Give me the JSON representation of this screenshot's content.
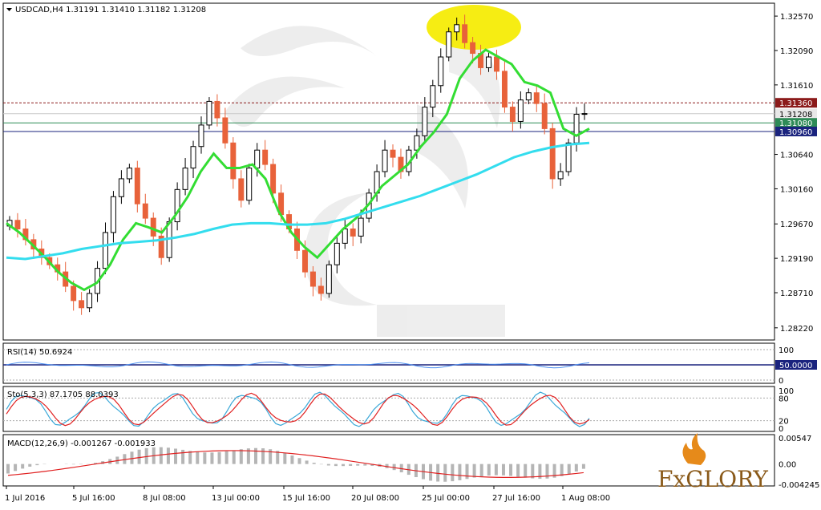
{
  "chart_data": {
    "type": "candlestick",
    "symbol_header": "USDCAD,H4  1.31191 1.31410 1.31182 1.31208",
    "price_axis": [
      "1.32570",
      "1.32090",
      "1.31610",
      "1.31360",
      "1.31208",
      "1.31080",
      "1.30960",
      "1.30640",
      "1.30160",
      "1.29670",
      "1.29190",
      "1.28710",
      "1.28220"
    ],
    "ylim": [
      1.2805,
      1.3275
    ],
    "time_labels": [
      "1 Jul 2016",
      "5 Jul 16:00",
      "8 Jul 08:00",
      "13 Jul 00:00",
      "15 Jul 16:00",
      "20 Jul 08:00",
      "25 Jul 00:00",
      "27 Jul 16:00",
      "1 Aug 08:00"
    ],
    "levels": [
      {
        "value": 1.3136,
        "label": "1.31360",
        "color": "#8b1a1a",
        "style": "dashed"
      },
      {
        "value": 1.31208,
        "label": "1.31208",
        "color": "#c8c8c8",
        "style": "solid"
      },
      {
        "value": 1.3108,
        "label": "1.31080",
        "color": "#2e8b57",
        "style": "solid"
      },
      {
        "value": 1.3096,
        "label": "1.30960",
        "color": "#1a237e",
        "style": "solid"
      }
    ],
    "candles": [
      1.2972,
      1.296,
      1.2945,
      1.2932,
      1.292,
      1.291,
      1.29,
      1.288,
      1.286,
      1.285,
      1.287,
      1.2905,
      1.2955,
      1.3005,
      1.303,
      1.3045,
      1.2995,
      1.2975,
      1.295,
      1.292,
      1.297,
      1.3015,
      1.3045,
      1.3075,
      1.3105,
      1.3138,
      1.3115,
      1.308,
      1.303,
      1.3,
      1.3045,
      1.307,
      1.305,
      1.301,
      1.298,
      1.296,
      1.293,
      1.29,
      1.288,
      1.287,
      1.291,
      1.294,
      1.296,
      1.295,
      1.2975,
      1.301,
      1.304,
      1.307,
      1.306,
      1.304,
      1.307,
      1.309,
      1.313,
      1.316,
      1.32,
      1.3235,
      1.3245,
      1.322,
      1.3205,
      1.3185,
      1.32,
      1.318,
      1.313,
      1.311,
      1.314,
      1.315,
      1.3135,
      1.31,
      1.303,
      1.304,
      1.308,
      1.312,
      1.3121
    ],
    "series": [
      {
        "name": "MA fast",
        "color": "#33dd33",
        "values": [
          1.2968,
          1.2955,
          1.2938,
          1.292,
          1.29,
          1.2885,
          1.2875,
          1.2885,
          1.291,
          1.2945,
          1.2968,
          1.2962,
          1.2955,
          1.2978,
          1.3005,
          1.304,
          1.3065,
          1.3045,
          1.3045,
          1.305,
          1.303,
          1.2985,
          1.2955,
          1.2935,
          1.292,
          1.294,
          1.296,
          1.2975,
          1.2995,
          1.302,
          1.3035,
          1.305,
          1.3075,
          1.3095,
          1.312,
          1.317,
          1.3195,
          1.321,
          1.32,
          1.319,
          1.3165,
          1.316,
          1.315,
          1.31,
          1.309,
          1.31
        ]
      },
      {
        "name": "MA slow",
        "color": "#33ddee",
        "values": [
          1.292,
          1.2918,
          1.2922,
          1.2926,
          1.2932,
          1.2936,
          1.294,
          1.2942,
          1.2944,
          1.2948,
          1.2953,
          1.296,
          1.2966,
          1.2968,
          1.2968,
          1.2966,
          1.2966,
          1.2968,
          1.2974,
          1.2982,
          1.299,
          1.2998,
          1.3006,
          1.3016,
          1.3026,
          1.3036,
          1.3048,
          1.306,
          1.3068,
          1.3074,
          1.3078,
          1.308
        ]
      }
    ],
    "rsi": {
      "label": "RSI(14) 50.6924",
      "levels": [
        "100",
        "50.0000",
        "0"
      ]
    },
    "stochastic": {
      "label": "Sto(5,3,3) 87.1705 88.0393",
      "levels": [
        "100",
        "80",
        "20",
        "0"
      ]
    },
    "macd": {
      "label": "MACD(12,26,9) -0.001267 -0.001933",
      "levels": [
        "0.00547",
        "0.00",
        "-0.004245"
      ]
    }
  },
  "brand": {
    "logo": "FxGLORY"
  }
}
